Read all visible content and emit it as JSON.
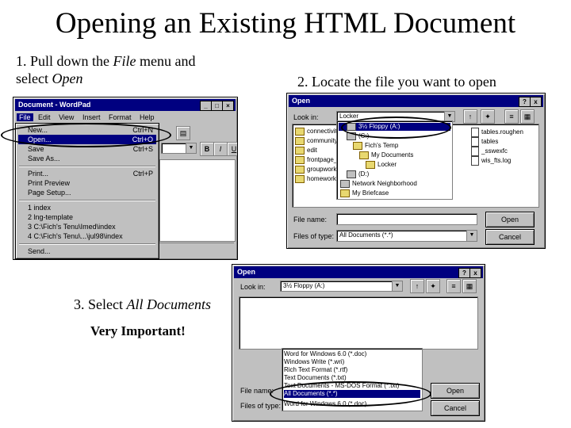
{
  "title": "Opening an Existing HTML Document",
  "steps": {
    "s1_pre": "1.  Pull down the ",
    "s1_file": "File",
    "s1_mid": " menu and",
    "s1_pre2": "select ",
    "s1_open": "Open",
    "s2": "2.  Locate the file you want to open",
    "s3_pre": "3.  Select ",
    "s3_all": "All Documents",
    "important": "Very Important!"
  },
  "wordpad": {
    "title": "Document - WordPad",
    "menubar": [
      "File",
      "Edit",
      "View",
      "Insert",
      "Format",
      "Help"
    ],
    "menu_items": [
      {
        "label": "New...",
        "shortcut": "Ctrl+N"
      },
      {
        "label": "Open...",
        "shortcut": "Ctrl+O"
      },
      {
        "label": "Save",
        "shortcut": "Ctrl+S"
      },
      {
        "label": "Save As...",
        "shortcut": ""
      },
      {
        "label": "Print...",
        "shortcut": "Ctrl+P"
      },
      {
        "label": "Print Preview",
        "shortcut": ""
      },
      {
        "label": "Page Setup...",
        "shortcut": ""
      },
      {
        "label": "1 index",
        "shortcut": ""
      },
      {
        "label": "2 lng-template",
        "shortcut": ""
      },
      {
        "label": "3 C:\\Fich's Tenu\\Imed\\index",
        "shortcut": ""
      },
      {
        "label": "4 C:\\Fich's Tenu\\...\\jul98\\index",
        "shortcut": ""
      },
      {
        "label": "Send...",
        "shortcut": ""
      }
    ],
    "bold": "B",
    "italic": "I",
    "underline": "U"
  },
  "open1": {
    "title": "Open",
    "help_btn": "?",
    "close_btn": "x",
    "look_in_label": "Look in:",
    "look_in_value": "Locker",
    "tree": [
      "3½ Floppy (A:)",
      "(C:)",
      "Fich's Temp",
      "My Documents",
      "Locker",
      "(D:)",
      "Network Neighborhood",
      "My Briefcase"
    ],
    "left_files": [
      "connectivity",
      "community",
      "edit",
      "frontpage_",
      "groupwork",
      "homework"
    ],
    "right_files": [
      "tables.roughen",
      "tables",
      "_sswexfc",
      "wis_fts.log"
    ],
    "file_name_label": "File name:",
    "file_type_label": "Files of type:",
    "file_name_value": "",
    "file_type_value": "All Documents (*.*)",
    "open_btn": "Open",
    "cancel_btn": "Cancel"
  },
  "open2": {
    "title": "Open",
    "help_btn": "?",
    "close_btn": "x",
    "look_in_label": "Look in:",
    "look_in_value": "3½ Floppy (A:)",
    "types": [
      "Word for Windows 6.0 (*.doc)",
      "Windows Write (*.wri)",
      "Rich Text Format (*.rtf)",
      "Text Documents (*.txt)",
      "Text Documents - MS-DOS Format (*.txt)",
      "All Documents (*.*)",
      "Word for Windows 6.0 (*.doc)"
    ],
    "selected_type": 5,
    "file_name_label": "File name:",
    "file_type_label": "Files of type:",
    "open_btn": "Open",
    "cancel_btn": "Cancel"
  }
}
